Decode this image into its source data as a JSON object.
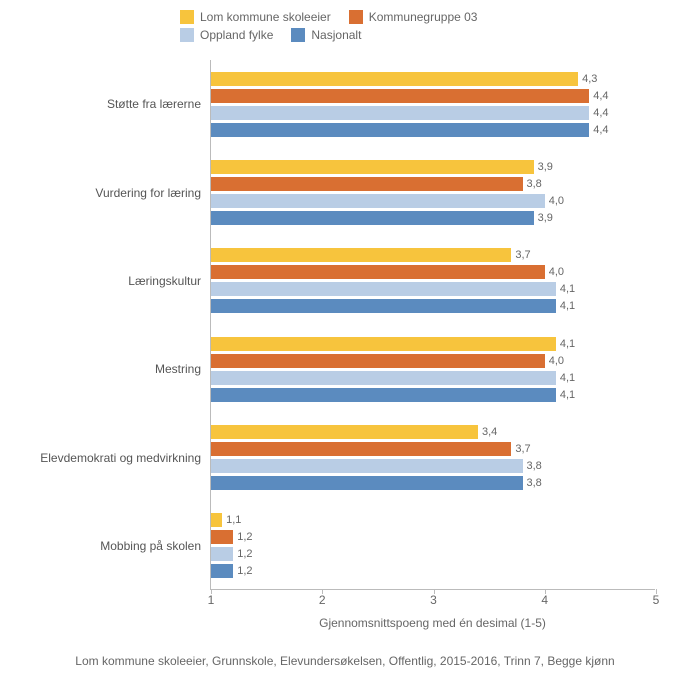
{
  "chart_data": {
    "type": "bar",
    "orientation": "horizontal",
    "xlabel": "Gjennomsnittspoeng med én desimal (1-5)",
    "xlim": [
      1,
      5
    ],
    "xticks": [
      1,
      2,
      3,
      4,
      5
    ],
    "categories": [
      "Støtte fra lærerne",
      "Vurdering for læring",
      "Læringskultur",
      "Mestring",
      "Elevdemokrati og medvirkning",
      "Mobbing på skolen"
    ],
    "series": [
      {
        "name": "Lom kommune skoleeier",
        "color": "#f7c43d",
        "values": [
          4.3,
          3.9,
          3.7,
          4.1,
          3.4,
          1.1
        ]
      },
      {
        "name": "Kommunegruppe 03",
        "color": "#d96f32",
        "values": [
          4.4,
          3.8,
          4.0,
          4.0,
          3.7,
          1.2
        ]
      },
      {
        "name": "Oppland fylke",
        "color": "#b9cde5",
        "values": [
          4.4,
          4.0,
          4.1,
          4.1,
          3.8,
          1.2
        ]
      },
      {
        "name": "Nasjonalt",
        "color": "#5b8bbf",
        "values": [
          4.4,
          3.9,
          4.1,
          4.1,
          3.8,
          1.2
        ]
      }
    ],
    "caption": "Lom kommune skoleeier, Grunnskole, Elevundersøkelsen, Offentlig, 2015-2016, Trinn 7, Begge kjønn"
  }
}
